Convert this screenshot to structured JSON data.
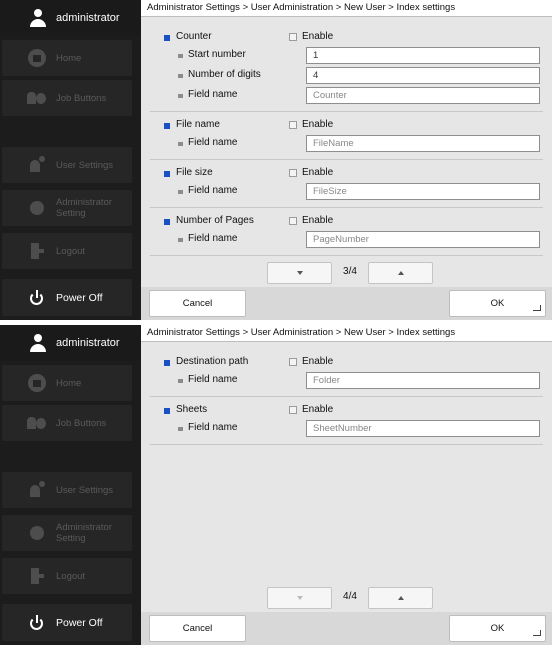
{
  "sidebar": {
    "user_name": "administrator",
    "items": [
      {
        "label": "Home",
        "icon": "home-icon"
      },
      {
        "label": "Job Buttons",
        "icon": "job-buttons-icon"
      },
      {
        "label": "User Settings",
        "icon": "user-settings-icon"
      },
      {
        "label": "Administrator Setting",
        "label_line1": "Administrator",
        "label_line2": "Setting",
        "icon": "gear-icon"
      },
      {
        "label": "Logout",
        "icon": "logout-icon"
      }
    ],
    "power_off_label": "Power Off"
  },
  "breadcrumb": "Administrator Settings > User Administration > New User > Index settings",
  "screen1": {
    "sections": [
      {
        "label": "Counter",
        "enable_label": "Enable",
        "enabled": false,
        "subfields": [
          {
            "label": "Start number",
            "value": "1"
          },
          {
            "label": "Number of digits",
            "value": "4"
          },
          {
            "label": "Field name",
            "value": "Counter"
          }
        ]
      },
      {
        "label": "File name",
        "enable_label": "Enable",
        "enabled": false,
        "subfields": [
          {
            "label": "Field name",
            "value": "FileName"
          }
        ]
      },
      {
        "label": "File size",
        "enable_label": "Enable",
        "enabled": false,
        "subfields": [
          {
            "label": "Field name",
            "value": "FileSize"
          }
        ]
      },
      {
        "label": "Number of Pages",
        "enable_label": "Enable",
        "enabled": false,
        "subfields": [
          {
            "label": "Field name",
            "value": "PageNumber"
          }
        ]
      }
    ],
    "page_indicator": "3/4"
  },
  "screen2": {
    "sections": [
      {
        "label": "Destination path",
        "enable_label": "Enable",
        "enabled": false,
        "subfields": [
          {
            "label": "Field name",
            "value": "Folder"
          }
        ]
      },
      {
        "label": "Sheets",
        "enable_label": "Enable",
        "enabled": false,
        "subfields": [
          {
            "label": "Field name",
            "value": "SheetNumber"
          }
        ]
      }
    ],
    "page_indicator": "4/4"
  },
  "actions": {
    "cancel_label": "Cancel",
    "ok_label": "OK"
  },
  "colors": {
    "accent_bullet": "#1b4fc4",
    "sidebar_bg": "#1c1c1c",
    "panel_bg": "#e6e6e6"
  }
}
